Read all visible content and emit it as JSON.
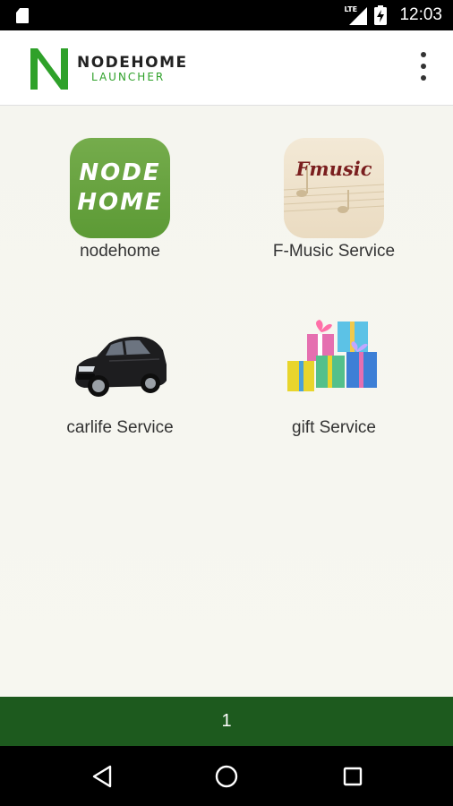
{
  "status_bar": {
    "network": "LTE",
    "time": "12:03"
  },
  "header": {
    "logo_title": "NODEHOME",
    "logo_subtitle": "LAUNCHER",
    "brand_color": "#2fa12a",
    "menu_icon": "more-vert-icon"
  },
  "apps": [
    {
      "label": "nodehome",
      "icon": "nodehome-app-icon",
      "icon_text": [
        "NODE",
        "HOME"
      ]
    },
    {
      "label": "F-Music Service",
      "icon": "fmusic-app-icon",
      "icon_text": [
        "Fmusic"
      ]
    },
    {
      "label": "carlife Service",
      "icon": "car-app-icon"
    },
    {
      "label": "gift Service",
      "icon": "gift-app-icon"
    }
  ],
  "pager": {
    "page_number": "1",
    "color": "#1d5a1e"
  },
  "nav_bar": {
    "buttons": [
      "back-icon",
      "home-icon",
      "recents-icon"
    ]
  }
}
